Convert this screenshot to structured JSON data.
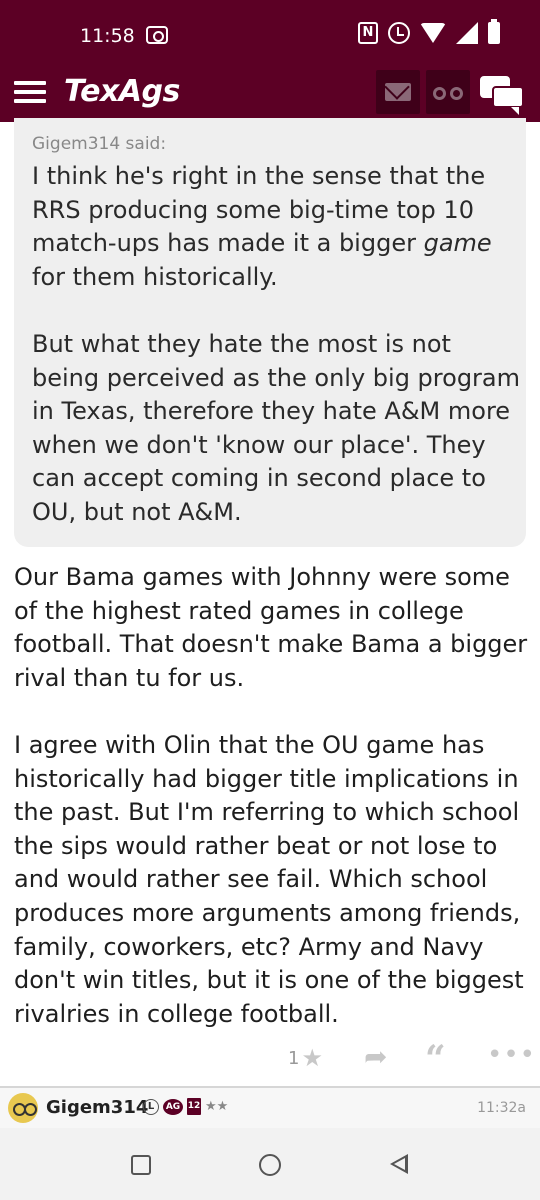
{
  "status_bar": {
    "time": "11:58",
    "icons": [
      "cast-icon",
      "nfc-icon",
      "alarm-icon",
      "wifi-icon",
      "signal-icon",
      "battery-icon"
    ],
    "nfc_label": "N"
  },
  "app_bar": {
    "brand": "TexAgs",
    "icons": [
      "menu-icon",
      "mail-icon",
      "binoculars-icon",
      "chat-bubbles-icon"
    ],
    "color": "#5c0025"
  },
  "quote": {
    "author": "Gigem314 said:",
    "paragraphs": [
      {
        "before": "I think he's right in the sense that the RRS producing some big-time top 10 match-ups has made it a bigger ",
        "emphasis": "game",
        "after": " for them historically."
      },
      {
        "before": "But what they hate the most is not being perceived as the only big program in Texas, therefore they hate A&M more when we don't 'know our place'. They can accept coming in second place to OU, but not A&M.",
        "emphasis": "",
        "after": ""
      }
    ]
  },
  "post": {
    "paragraphs": [
      "Our Bama games with Johnny were some of the highest rated games in college football. That doesn't make Bama a bigger rival than tu for us.",
      "I agree with Olin that the OU game has historically had bigger title implications in the past. But I'm referring to which school the sips would rather beat or not lose to and would rather see fail. Which school produces more arguments among friends, family, coworkers, etc? Army and Navy don't win titles, but it is one of the biggest rivalries in college football."
    ],
    "actions": {
      "like_count": "1",
      "icons": [
        "star-icon",
        "reply-icon",
        "quote-icon",
        "more-icon"
      ]
    }
  },
  "next_post": {
    "username": "Gigem314",
    "badge_l": "L",
    "badge_ag": "AG",
    "badge_12": "12",
    "stars": "★★",
    "time": "11:32a"
  },
  "nav_bar": {
    "icons": [
      "recents-icon",
      "home-icon",
      "back-icon"
    ]
  }
}
